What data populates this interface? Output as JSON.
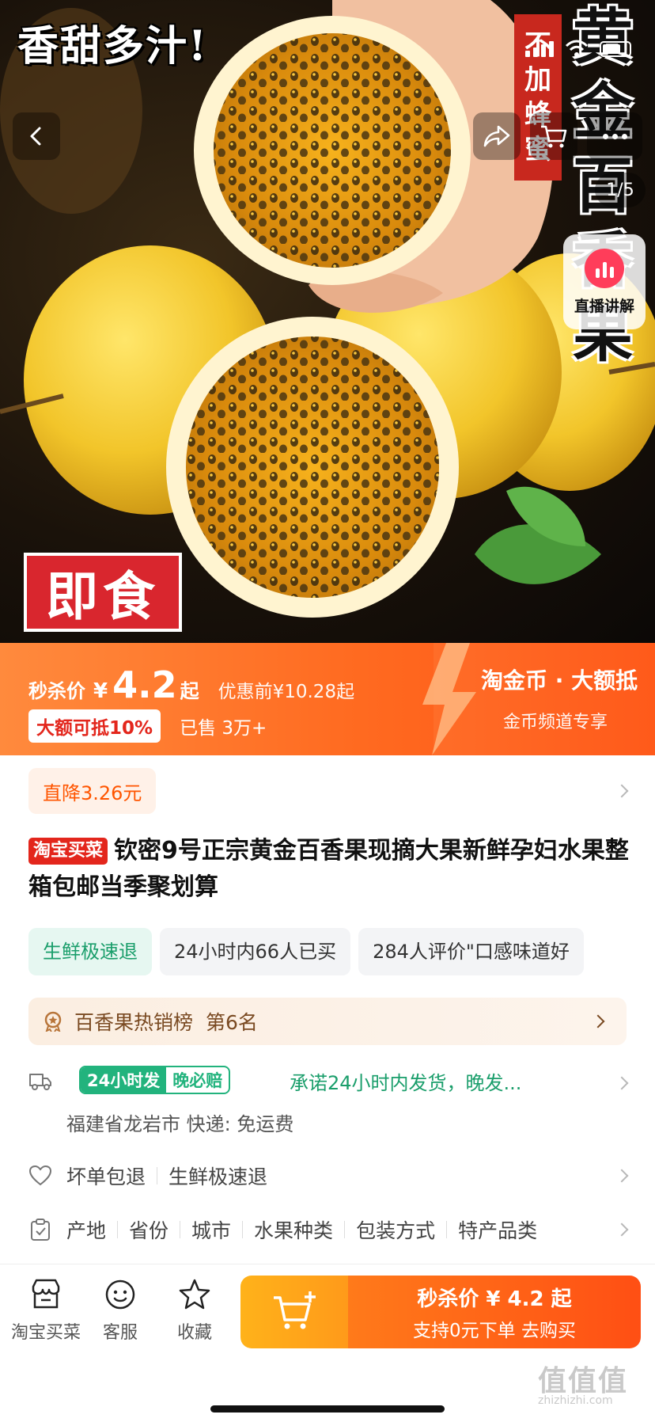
{
  "hero": {
    "banner_top": "香甜多汁!",
    "banner_red": [
      "不",
      "加",
      "蜂",
      "蜜"
    ],
    "banner_vertical": [
      "黄",
      "金",
      "百",
      "香",
      "果"
    ],
    "badge_ready": "即食",
    "image_counter": "1/5",
    "live_label": "直播讲解"
  },
  "price": {
    "label": "秒杀价",
    "yen": "¥",
    "amount": "4.2",
    "suffix": "起",
    "before": "优惠前¥10.28起",
    "discount_tag": "大额可抵10%",
    "sold": "已售 3万+",
    "coin_title": "淘金币 · 大额抵",
    "coin_sub": "金币频道专享"
  },
  "price_cut": "直降3.26元",
  "product": {
    "tag": "淘宝买菜",
    "title": "钦密9号正宗黄金百香果现摘大果新鲜孕妇水果整箱包邮当季聚划算"
  },
  "tags": [
    {
      "label": "生鲜极速退",
      "style": "green"
    },
    {
      "label": "24小时内66人已买",
      "style": "gray"
    },
    {
      "label": "284人评价\"口感味道好",
      "style": "gray"
    }
  ],
  "rank": {
    "text": "百香果热销榜",
    "position": "第6名"
  },
  "shipping": {
    "badge_a": "24小时发",
    "badge_b": "晚必赔",
    "promise": "承诺24小时内发货，晚发...",
    "origin": "福建省龙岩市  快递: 免运费"
  },
  "services": [
    "坏单包退",
    "生鲜极速退"
  ],
  "attributes": [
    "产地",
    "省份",
    "城市",
    "水果种类",
    "包装方式",
    "特产品类"
  ],
  "bottom_bar": {
    "shop": "淘宝买菜",
    "service": "客服",
    "favorite": "收藏",
    "buy_line1": "秒杀价 ¥ 4.2 起",
    "buy_line2": "支持0元下单  去购买",
    "watermark": "值值值",
    "watermark_sub": "zhizhizhi.com"
  },
  "colors": {
    "accent": "#ff5500",
    "price_bg": "#ff6a20",
    "tag_red": "#e3261c",
    "green": "#1a9e6b"
  }
}
